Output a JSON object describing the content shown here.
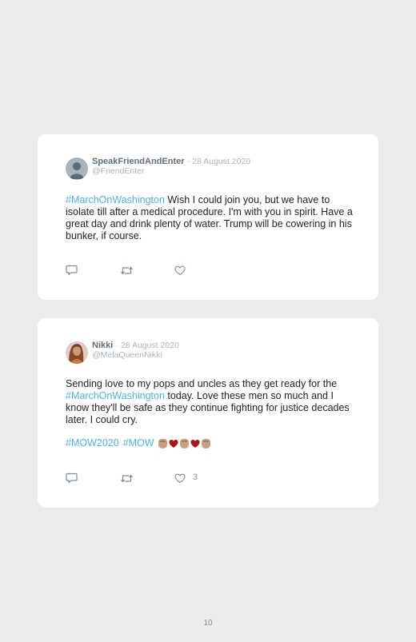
{
  "tweets": [
    {
      "name": "SpeakFriendAndEnter",
      "dot": "·",
      "date": "28 August 2020",
      "handle": "@FriendEnter",
      "hashtag": "#MarchOnWashington",
      "text": " Wish I could join you, but we have to isolate till after a medical procedure. I'm with you in spirit. Have a great day and drink plenty of water. Trump will be cowering in his bunker, if course.",
      "likes": ""
    },
    {
      "name": "Nikki",
      "dot": "·",
      "date": "28 August 2020",
      "handle": "@MelaQueenNikki",
      "text_before": "Sending love to my pops and uncles as they get ready for the ",
      "hashtag": "#MarchOnWashington",
      "text_after": " today. Love these men so much and I know they'll be safe as they continue fighting for justice decades later. I could cry.",
      "tag1": "#MOW2020",
      "tag2": "#MOW",
      "likes": "3"
    }
  ],
  "icons": {
    "reply": "reply-icon",
    "retweet": "retweet-icon",
    "like": "heart-icon",
    "avatar_default": "default-avatar-icon"
  },
  "colors": {
    "background": "#ebebeb",
    "card": "#ffffff",
    "hashtag": "#4fb1dc",
    "name": "#5f6f80",
    "muted": "#aab4bf",
    "heart_emoji": "#a4171d",
    "fist_emoji": "#c8a07d"
  },
  "page": {
    "number": "10"
  }
}
